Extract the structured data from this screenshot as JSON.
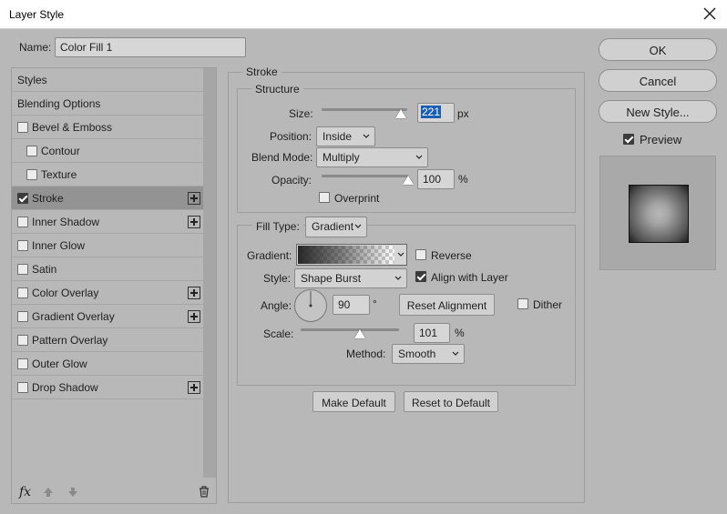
{
  "window": {
    "title": "Layer Style"
  },
  "name_field": {
    "label": "Name:",
    "value": "Color Fill 1"
  },
  "style_list": {
    "items": [
      {
        "label": "Styles",
        "has_checkbox": false,
        "checked": false,
        "selected": false,
        "has_plus": false
      },
      {
        "label": "Blending Options",
        "has_checkbox": false,
        "checked": false,
        "selected": false,
        "has_plus": false
      },
      {
        "label": "Bevel & Emboss",
        "has_checkbox": true,
        "checked": false,
        "selected": false,
        "has_plus": false
      },
      {
        "label": "Contour",
        "has_checkbox": true,
        "checked": false,
        "selected": false,
        "has_plus": false,
        "indent": true
      },
      {
        "label": "Texture",
        "has_checkbox": true,
        "checked": false,
        "selected": false,
        "has_plus": false,
        "indent": true
      },
      {
        "label": "Stroke",
        "has_checkbox": true,
        "checked": true,
        "selected": true,
        "has_plus": true
      },
      {
        "label": "Inner Shadow",
        "has_checkbox": true,
        "checked": false,
        "selected": false,
        "has_plus": true
      },
      {
        "label": "Inner Glow",
        "has_checkbox": true,
        "checked": false,
        "selected": false,
        "has_plus": false
      },
      {
        "label": "Satin",
        "has_checkbox": true,
        "checked": false,
        "selected": false,
        "has_plus": false
      },
      {
        "label": "Color Overlay",
        "has_checkbox": true,
        "checked": false,
        "selected": false,
        "has_plus": true
      },
      {
        "label": "Gradient Overlay",
        "has_checkbox": true,
        "checked": false,
        "selected": false,
        "has_plus": true
      },
      {
        "label": "Pattern Overlay",
        "has_checkbox": true,
        "checked": false,
        "selected": false,
        "has_plus": false
      },
      {
        "label": "Outer Glow",
        "has_checkbox": true,
        "checked": false,
        "selected": false,
        "has_plus": false
      },
      {
        "label": "Drop Shadow",
        "has_checkbox": true,
        "checked": false,
        "selected": false,
        "has_plus": true
      }
    ],
    "footer_icons": [
      "fx-icon",
      "arrow-up-icon",
      "arrow-down-icon",
      "trash-icon"
    ],
    "fx_label": "fx"
  },
  "stroke": {
    "title": "Stroke",
    "structure": {
      "title": "Structure",
      "size_label": "Size:",
      "size_value": "221",
      "size_unit": "px",
      "size_fraction": 0.93,
      "position_label": "Position:",
      "position_value": "Inside",
      "blend_mode_label": "Blend Mode:",
      "blend_mode_value": "Multiply",
      "opacity_label": "Opacity:",
      "opacity_value": "100",
      "opacity_unit": "%",
      "opacity_fraction": 1.0,
      "overprint_label": "Overprint",
      "overprint_checked": false
    },
    "fill": {
      "fill_type_label": "Fill Type:",
      "fill_type_value": "Gradient",
      "gradient_label": "Gradient:",
      "reverse_label": "Reverse",
      "reverse_checked": false,
      "style_label": "Style:",
      "style_value": "Shape Burst",
      "align_label": "Align with Layer",
      "align_checked": true,
      "angle_label": "Angle:",
      "angle_value": "90",
      "angle_unit": "°",
      "reset_alignment_label": "Reset Alignment",
      "dither_label": "Dither",
      "dither_checked": false,
      "scale_label": "Scale:",
      "scale_value": "101",
      "scale_unit": "%",
      "scale_fraction": 0.6,
      "method_label": "Method:",
      "method_value": "Smooth"
    },
    "make_default_label": "Make Default",
    "reset_default_label": "Reset to Default"
  },
  "right": {
    "ok_label": "OK",
    "cancel_label": "Cancel",
    "new_style_label": "New Style...",
    "preview_label": "Preview",
    "preview_checked": true
  },
  "colors": {
    "dialog_bg": "#b8b8b8",
    "selected_item": "#939393",
    "text": "#1e1e1e"
  }
}
